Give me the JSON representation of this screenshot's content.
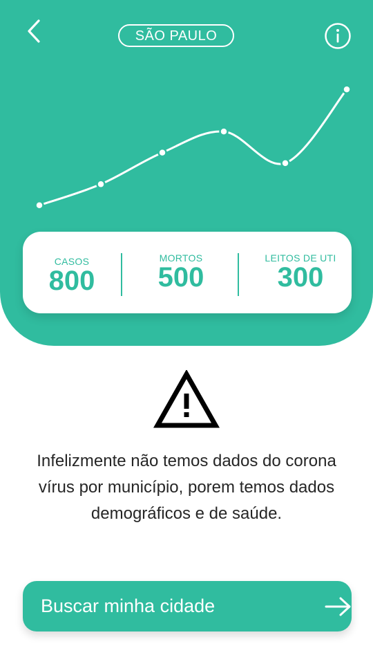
{
  "header": {
    "city": "SÃO PAULO",
    "back_icon": "chevron-left-icon",
    "info_icon": "info-icon"
  },
  "chart_data": {
    "type": "line",
    "title": "",
    "xlabel": "",
    "ylabel": "",
    "x": [
      1,
      2,
      3,
      4,
      5,
      6
    ],
    "values": [
      1,
      3,
      6,
      8,
      5,
      12
    ],
    "ylim": [
      0,
      13
    ],
    "grid": false
  },
  "stats": [
    {
      "label": "CASOS",
      "value": "800"
    },
    {
      "label": "MORTOS",
      "value": "500"
    },
    {
      "label": "LEITOS DE UTI",
      "value": "300"
    }
  ],
  "notice": {
    "icon": "warning-icon",
    "text": "Infelizmente não temos dados do corona vírus por município, porem temos dados demográficos e de saúde."
  },
  "action": {
    "label": "Buscar minha cidade",
    "icon": "arrow-right-icon"
  },
  "colors": {
    "brand": "#30bc9f",
    "text": "#262626",
    "card": "#ffffff"
  }
}
